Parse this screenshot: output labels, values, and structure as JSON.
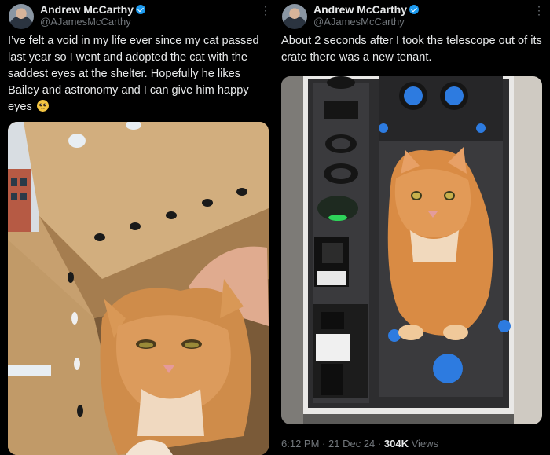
{
  "left_tweet": {
    "author_name": "Andrew McCarthy",
    "author_handle": "@AJamesMcCarthy",
    "more_icon": "more-vertical-icon",
    "text": "I’ve felt a void in my life ever since my cat passed last year so I went and adopted the cat with the saddest eyes at the shelter. Hopefully he likes Bailey and astronomy and I can give him happy eyes",
    "emoji": "pleading-face-emoji"
  },
  "right_tweet": {
    "author_name": "Andrew McCarthy",
    "author_handle": "@AJamesMcCarthy",
    "more_icon": "more-vertical-icon",
    "text": "About 2 seconds after I took the telescope out of its crate there was a new tenant.",
    "time": "6:12 PM",
    "date": "21 Dec 24",
    "views_count": "304K",
    "views_label": "Views"
  },
  "colors": {
    "background": "#000000",
    "text_primary": "#e7e9ea",
    "text_secondary": "#71767b",
    "verified_badge": "#1d9bf0"
  }
}
